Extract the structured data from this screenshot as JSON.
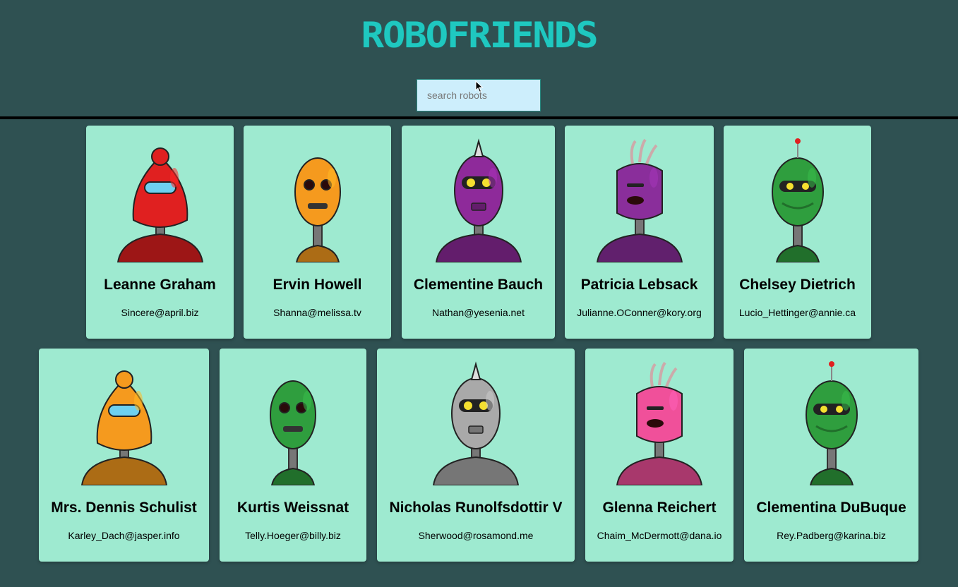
{
  "app": {
    "title": "ROBOFRIENDS"
  },
  "search": {
    "placeholder": "search robots",
    "value": ""
  },
  "colors": {
    "background": "#2f5152",
    "card": "#9eead0",
    "logo": "#1fc8c0",
    "search_bg": "#cdeefc"
  },
  "robots": [
    {
      "name": "Leanne Graham",
      "email": "Sincere@april.biz",
      "color": "#e02020",
      "icon": "red-robot-icon"
    },
    {
      "name": "Ervin Howell",
      "email": "Shanna@melissa.tv",
      "color": "#f59a1e",
      "icon": "orange-robot-icon"
    },
    {
      "name": "Clementine Bauch",
      "email": "Nathan@yesenia.net",
      "color": "#8e2a9a",
      "icon": "purple-robot-icon"
    },
    {
      "name": "Patricia Lebsack",
      "email": "Julianne.OConner@kory.org",
      "color": "#8a2e9b",
      "icon": "purple-robot-icon"
    },
    {
      "name": "Chelsey Dietrich",
      "email": "Lucio_Hettinger@annie.ca",
      "color": "#2f9e3e",
      "icon": "green-robot-icon"
    },
    {
      "name": "Mrs. Dennis Schulist",
      "email": "Karley_Dach@jasper.info",
      "color": "#f59a1e",
      "icon": "orange-robot-icon"
    },
    {
      "name": "Kurtis Weissnat",
      "email": "Telly.Hoeger@billy.biz",
      "color": "#2f9e3e",
      "icon": "green-robot-icon"
    },
    {
      "name": "Nicholas Runolfsdottir V",
      "email": "Sherwood@rosamond.me",
      "color": "#a9a9a9",
      "icon": "gray-robot-icon"
    },
    {
      "name": "Glenna Reichert",
      "email": "Chaim_McDermott@dana.io",
      "color": "#f0509a",
      "icon": "pink-robot-icon"
    },
    {
      "name": "Clementina DuBuque",
      "email": "Rey.Padberg@karina.biz",
      "color": "#2f9e3e",
      "icon": "green-robot-icon"
    }
  ]
}
